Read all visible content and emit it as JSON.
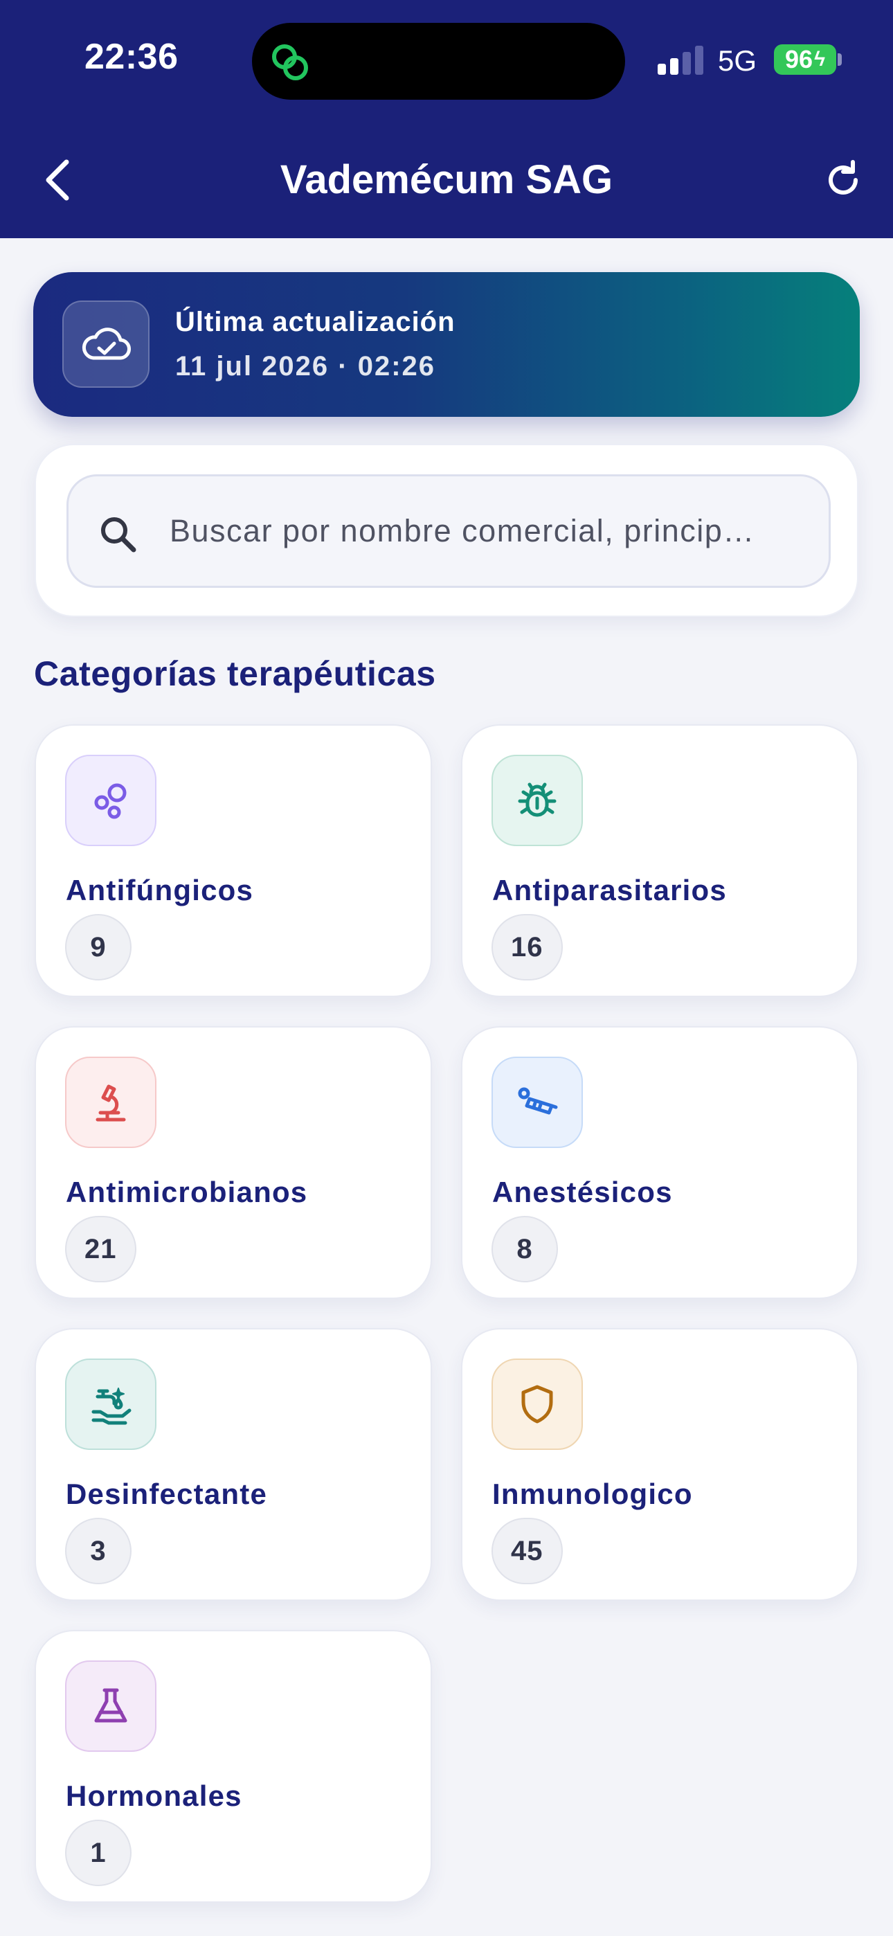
{
  "status_bar": {
    "time": "22:36",
    "network": "5G",
    "battery": "96"
  },
  "header": {
    "title": "Vademécum SAG",
    "back_icon": "chevron-left-icon",
    "refresh_icon": "refresh-icon"
  },
  "update": {
    "title": "Última actualización",
    "date": "11 jul 2026 · 02:26",
    "icon": "cloud-check-icon"
  },
  "search": {
    "placeholder": "Buscar por nombre comercial, princip…",
    "value": ""
  },
  "section": {
    "title": "Categorías terapéuticas"
  },
  "categories": [
    {
      "name": "Antifúngicos",
      "count": "9",
      "icon": "spores-icon",
      "color": "#7b5ce6",
      "bg": "#f1edfe",
      "border": "#d9cffb"
    },
    {
      "name": "Antiparasitarios",
      "count": "16",
      "icon": "bug-icon",
      "color": "#148f77",
      "bg": "#e6f5f0",
      "border": "#bfe3d6"
    },
    {
      "name": "Antimicrobianos",
      "count": "21",
      "icon": "microscope-icon",
      "color": "#dc4e4e",
      "bg": "#fdeeee",
      "border": "#f6c9c9"
    },
    {
      "name": "Anestésicos",
      "count": "8",
      "icon": "syringe-icon",
      "color": "#2b6fdb",
      "bg": "#e9f1fd",
      "border": "#c6dbf8"
    },
    {
      "name": "Desinfectante",
      "count": "3",
      "icon": "hand-wash-icon",
      "color": "#11807a",
      "bg": "#e5f3f1",
      "border": "#bde0da"
    },
    {
      "name": "Inmunologico",
      "count": "45",
      "icon": "shield-icon",
      "color": "#b26d10",
      "bg": "#fbf1e3",
      "border": "#efd6b2"
    },
    {
      "name": "Hormonales",
      "count": "1",
      "icon": "flask-icon",
      "color": "#8e3fb0",
      "bg": "#f5ebf9",
      "border": "#e2c9ee"
    }
  ]
}
